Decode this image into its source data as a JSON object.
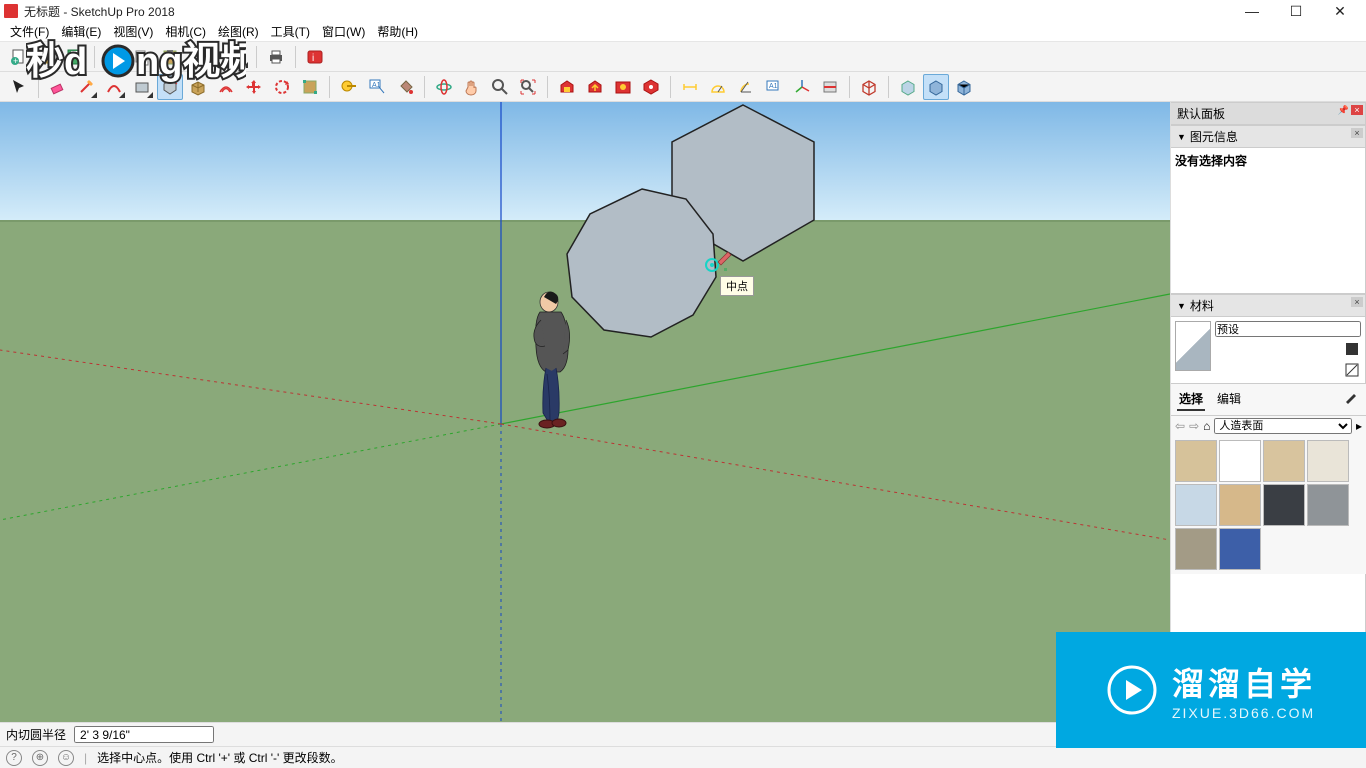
{
  "window": {
    "title": "无标题 - SketchUp Pro 2018"
  },
  "menu": {
    "items": [
      "文件(F)",
      "编辑(E)",
      "视图(V)",
      "相机(C)",
      "绘图(R)",
      "工具(T)",
      "窗口(W)",
      "帮助(H)"
    ]
  },
  "toolbar1_names": [
    "new-doc",
    "open-doc",
    "save-doc",
    "cut",
    "copy",
    "paste",
    "undo",
    "redo",
    "print",
    "model-info"
  ],
  "toolbar2_groups": [
    [
      "select-arrow",
      "eraser",
      "lines",
      "arcs",
      "rectangles",
      "circle",
      "polygon",
      "push-pull",
      "offset",
      "move",
      "rotate",
      "scale"
    ],
    [
      "tape-measure",
      "text-label",
      "paint-bucket"
    ],
    [
      "orbit",
      "pan-hand",
      "zoom",
      "zoom-extents"
    ],
    [
      "warehouse-get",
      "warehouse-share",
      "warehouse-ext",
      "extension-wh"
    ],
    [
      "dim-tool",
      "dim-angle",
      "protractor",
      "text-3d",
      "axes",
      "section"
    ],
    [
      "iso-view"
    ],
    [
      "xray",
      "back-edges",
      "shaded"
    ]
  ],
  "sidebar": {
    "default_tray": "默认面板",
    "entity_info": {
      "title": "图元信息",
      "content": "没有选择内容"
    },
    "materials": {
      "title": "材料",
      "preset_label": "预设",
      "tabs": {
        "select": "选择",
        "edit": "编辑"
      },
      "category": "人造表面",
      "swatches": [
        "#d6c29a",
        "#ffffff",
        "#d8c49e",
        "#e9e4d8",
        "#c7d8e6",
        "#d6b88a",
        "#3a3e44",
        "#8f9498",
        "#a39b86",
        "#3d5fa8"
      ]
    }
  },
  "viewport": {
    "tooltip": "中点"
  },
  "measure": {
    "label": "内切圆半径",
    "value": "2' 3 9/16\""
  },
  "status": {
    "hint": "选择中心点。使用 Ctrl '+' 或 Ctrl '-' 更改段数。"
  },
  "watermark2": {
    "big": "溜溜自学",
    "small": "ZIXUE.3D66.COM"
  },
  "icons": {
    "minimize": "—",
    "maximize": "☐",
    "close": "✕",
    "home": "⌂"
  }
}
